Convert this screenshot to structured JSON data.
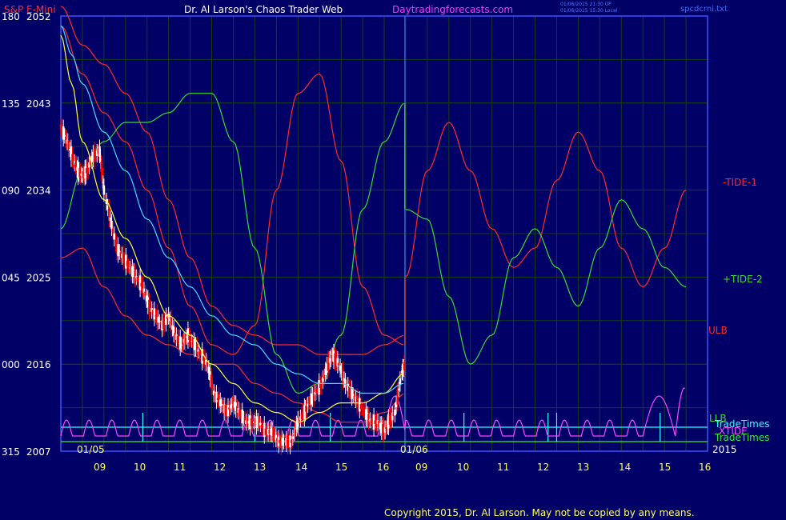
{
  "chart_data": {
    "type": "line",
    "title": "S&P E-Mini",
    "subtitle": "Dr. Al Larson's Chaos Trader Web",
    "site": "Daytradingforecasts.com",
    "timestamps": [
      "01/06/2015 21:30 UP",
      "01/06/2015 15:30 Local"
    ],
    "file_label": "spcdcrni.txt",
    "copyright": "Copyright 2015, Dr. Al Larson. May not be copied by any means.",
    "year_label": "2015",
    "grid": true,
    "colors": {
      "background": "#000066",
      "grid": "#173f17",
      "axis_labels": "#ffffff",
      "title": "#ff3030",
      "subtitle": "#ffffff",
      "site": "#ff33ff",
      "tide1": "#ff2a2a",
      "tide2": "#33dd33",
      "ulb": "#ff2a2a",
      "llb": "#ff2a2a",
      "xtide": "#ff44ff",
      "tradetimes_cyan": "#33ffff",
      "tradetimes_green": "#33ee33",
      "ema_yellow": "#ffff33",
      "ema_cyan": "#44ddff",
      "up_candle": "#ffffff",
      "down_candle": "#ff0000",
      "day_divider": "#3355ff"
    },
    "y_axis_left_labels": [
      {
        "tide": "180",
        "price": "2052"
      },
      {
        "tide": "135",
        "price": "2043"
      },
      {
        "tide": "090",
        "price": "2034"
      },
      {
        "tide": "045",
        "price": "2025"
      },
      {
        "tide": "000",
        "price": "2016"
      },
      {
        "tide": "315",
        "price": "2007"
      }
    ],
    "price_range": [
      2007,
      2052
    ],
    "x_tick_labels": [
      "09",
      "10",
      "11",
      "12",
      "13",
      "14",
      "15",
      "16",
      "09",
      "10",
      "11",
      "12",
      "13",
      "14",
      "15",
      "16"
    ],
    "date_labels": [
      "01/05",
      "01/06"
    ],
    "series_labels": [
      {
        "name": "-TIDE-1",
        "color": "#ff2a2a"
      },
      {
        "name": "+TIDE-2",
        "color": "#33dd33"
      },
      {
        "name": "ULB",
        "color": "#ff2a2a"
      },
      {
        "name": "LLB",
        "color": "#33dd33"
      },
      {
        "name": "TradeTimes",
        "color": "#33ffff"
      },
      {
        "name": "XTIDE",
        "color": "#ff44ff"
      },
      {
        "name": "TradeTimes",
        "color": "#33ee33"
      }
    ],
    "tide1": [
      [
        0,
        2051
      ],
      [
        1,
        2046
      ],
      [
        2,
        2042
      ],
      [
        3,
        2039
      ],
      [
        4,
        2034
      ],
      [
        5,
        2028
      ],
      [
        6,
        2022
      ],
      [
        7,
        2018
      ],
      [
        8,
        2017
      ],
      [
        9,
        2020
      ],
      [
        10,
        2034
      ],
      [
        11,
        2044
      ],
      [
        12,
        2046
      ],
      [
        13,
        2037
      ],
      [
        14,
        2024
      ],
      [
        15,
        2019
      ],
      [
        15.96,
        2018
      ],
      [
        16,
        2025
      ],
      [
        17,
        2036
      ],
      [
        18,
        2041
      ],
      [
        19,
        2036
      ],
      [
        20,
        2030
      ],
      [
        21,
        2026
      ],
      [
        22,
        2028
      ],
      [
        23,
        2035
      ],
      [
        24,
        2040
      ],
      [
        25,
        2036
      ],
      [
        26,
        2028
      ],
      [
        27,
        2024
      ],
      [
        28,
        2028
      ],
      [
        29,
        2034
      ]
    ],
    "tide2": [
      [
        0,
        2030
      ],
      [
        1,
        2036
      ],
      [
        2,
        2039
      ],
      [
        3,
        2041
      ],
      [
        4,
        2041
      ],
      [
        5,
        2042
      ],
      [
        6,
        2044
      ],
      [
        7,
        2044
      ],
      [
        8,
        2039
      ],
      [
        9,
        2028
      ],
      [
        10,
        2017
      ],
      [
        11,
        2013
      ],
      [
        12,
        2014
      ],
      [
        13,
        2019
      ],
      [
        14,
        2032
      ],
      [
        15,
        2039
      ],
      [
        15.96,
        2043
      ],
      [
        16,
        2032
      ],
      [
        17,
        2031
      ],
      [
        18,
        2023
      ],
      [
        19,
        2016
      ],
      [
        20,
        2019
      ],
      [
        21,
        2027
      ],
      [
        22,
        2030
      ],
      [
        23,
        2026
      ],
      [
        24,
        2022
      ],
      [
        25,
        2028
      ],
      [
        26,
        2033
      ],
      [
        27,
        2030
      ],
      [
        28,
        2026
      ],
      [
        29,
        2024
      ]
    ]
  }
}
